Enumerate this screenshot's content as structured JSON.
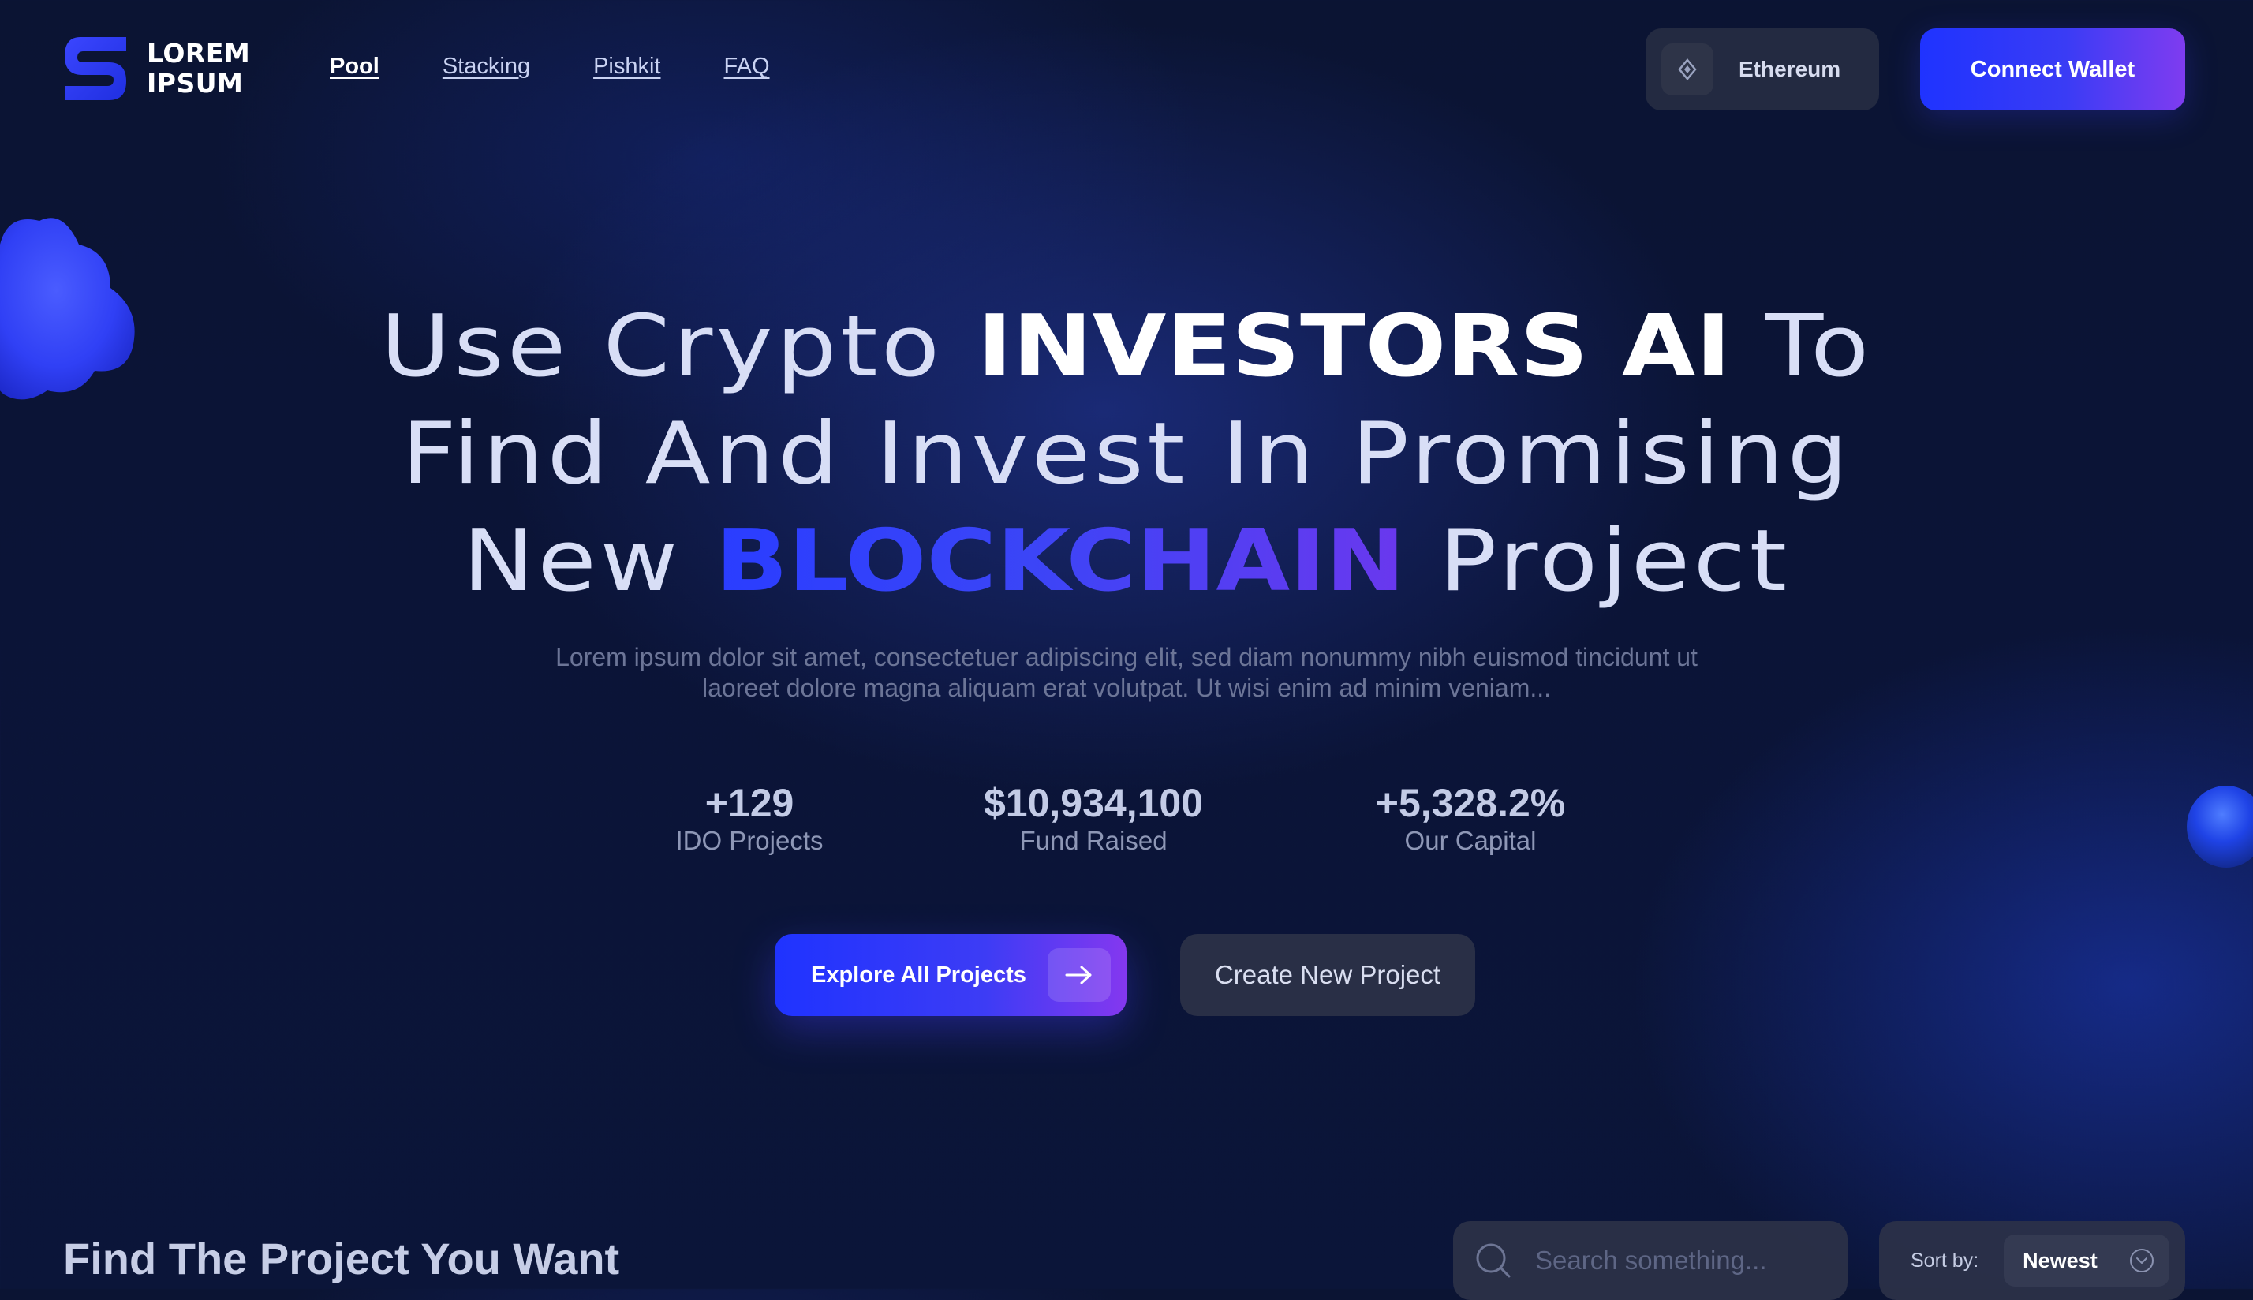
{
  "brand": {
    "line1": "LOREM",
    "line2": "IPSUM"
  },
  "nav": {
    "items": [
      {
        "label": "Pool",
        "active": true
      },
      {
        "label": "Stacking",
        "active": false
      },
      {
        "label": "Pishkit",
        "active": false
      },
      {
        "label": "FAQ",
        "active": false
      }
    ]
  },
  "header": {
    "network": {
      "label": "Ethereum",
      "icon": "ethereum-diamond-icon"
    },
    "connect_label": "Connect Wallet"
  },
  "hero": {
    "title": {
      "l1_a": "Use Crypto ",
      "l1_b": "INVESTORS AI",
      "l1_c": " To",
      "l2": "Find And Invest In Promising",
      "l3_a": "New ",
      "l3_b": "BLOCKCHAIN",
      "l3_c": " Project"
    },
    "description": "Lorem ipsum dolor sit amet, consectetuer adipiscing elit, sed diam nonummy nibh euismod tincidunt ut laoreet dolore magna aliquam erat volutpat. Ut wisi enim ad minim veniam...",
    "stats": [
      {
        "value": "+129",
        "label": "IDO Projects"
      },
      {
        "value": "$10,934,100",
        "label": "Fund Raised"
      },
      {
        "value": "+5,328.2%",
        "label": "Our Capital"
      }
    ],
    "explore_label": "Explore All Projects",
    "create_label": "Create New Project"
  },
  "projects": {
    "title": "Find The Project You Want",
    "search_placeholder": "Search something...",
    "sort_label": "Sort by:",
    "sort_value": "Newest"
  },
  "colors": {
    "accent_blue": "#1f33ff",
    "accent_purple": "#8438ef",
    "background": "#0b1437"
  }
}
